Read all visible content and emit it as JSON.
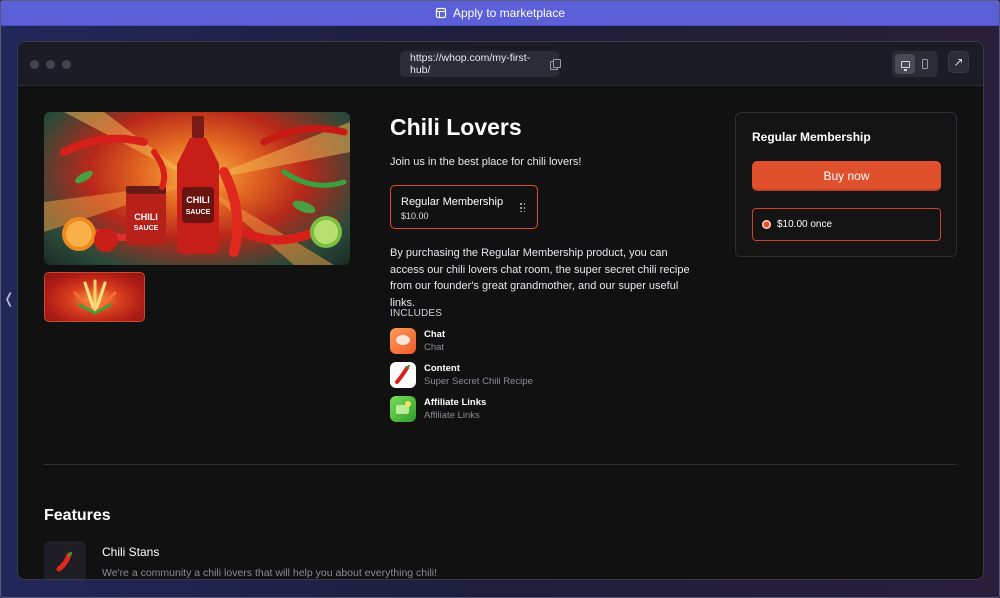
{
  "banner": {
    "label": "Apply to marketplace",
    "icon": "store-icon"
  },
  "browser": {
    "url": "https://whop.com/my-first-hub/"
  },
  "product": {
    "title": "Chili Lovers",
    "tagline": "Join us in the best place for chili lovers!",
    "plan": {
      "name": "Regular Membership",
      "price": "$10.00"
    },
    "description": "By purchasing the Regular Membership product, you can access our chili lovers chat room, the super secret chili recipe from our founder's great grandmother, and our super useful links.",
    "includes_label": "INCLUDES",
    "includes": [
      {
        "name": "Chat",
        "subtitle": "Chat",
        "icon": "chat-app-icon"
      },
      {
        "name": "Content",
        "subtitle": "Super Secret Chili Recipe",
        "icon": "chili-pepper-icon"
      },
      {
        "name": "Affiliate Links",
        "subtitle": "Affiliate Links",
        "icon": "affiliate-app-icon"
      }
    ]
  },
  "checkout": {
    "title": "Regular Membership",
    "buy_label": "Buy now",
    "price_option": "$10.00 once"
  },
  "features": {
    "title": "Features",
    "items": [
      {
        "name": "Chili Stans",
        "description": "We're a community a chili lovers that will help you about everything chili!"
      }
    ]
  },
  "colors": {
    "accent": "#e0502c",
    "banner": "#5b5fd8",
    "background": "#111111"
  }
}
